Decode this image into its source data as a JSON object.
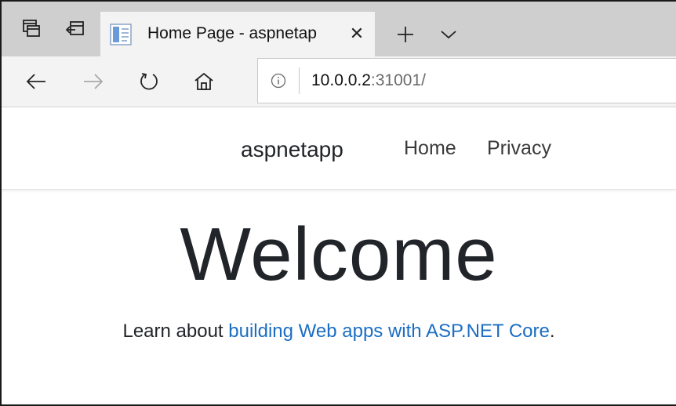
{
  "browser": {
    "tab": {
      "title": "Home Page - aspnetap",
      "close_glyph": "✕",
      "favicon": "page-icon"
    },
    "new_tab_glyph": "+",
    "tab_list_glyph": "⌄",
    "address": {
      "host": "10.0.0.2",
      "rest": ":31001/",
      "info_icon": "info-icon"
    }
  },
  "site": {
    "brand": "aspnetapp",
    "nav": {
      "home": "Home",
      "privacy": "Privacy"
    },
    "welcome": "Welcome",
    "learn_prefix": "Learn about ",
    "learn_link": "building Web apps with ASP.NET Core",
    "learn_suffix": "."
  },
  "colors": {
    "tabstrip_bg": "#cfcfcf",
    "link": "#1b6ec2",
    "text": "#212529"
  }
}
